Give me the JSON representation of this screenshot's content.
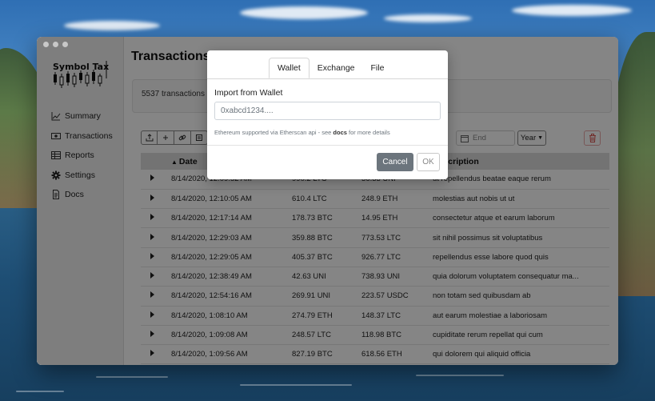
{
  "app": {
    "logo_text": "Symbol Tax",
    "page_title": "Transactions"
  },
  "sidebar": {
    "items": [
      {
        "label": "Summary",
        "icon": "chart-line-icon"
      },
      {
        "label": "Transactions",
        "icon": "cash-icon"
      },
      {
        "label": "Reports",
        "icon": "table-icon"
      },
      {
        "label": "Settings",
        "icon": "gear-icon"
      },
      {
        "label": "Docs",
        "icon": "document-icon"
      }
    ]
  },
  "summary": {
    "text": "5537 transactions"
  },
  "toolbar": {
    "icons": [
      "upload-icon",
      "plus-icon",
      "link-icon",
      "file-icon"
    ],
    "end_placeholder": "End",
    "year_label": "Year"
  },
  "table": {
    "columns": [
      "Date",
      "",
      "",
      "Description"
    ],
    "rows": [
      {
        "date": "8/14/2020, 12:09:52 AM",
        "sent": "990.2 LTC",
        "received": "36.33 UNI",
        "description": "ut repellendus beatae eaque rerum"
      },
      {
        "date": "8/14/2020, 12:10:05 AM",
        "sent": "610.4 LTC",
        "received": "248.9 ETH",
        "description": "molestias aut nobis ut ut"
      },
      {
        "date": "8/14/2020, 12:17:14 AM",
        "sent": "178.73 BTC",
        "received": "14.95 ETH",
        "description": "consectetur atque et earum laborum"
      },
      {
        "date": "8/14/2020, 12:29:03 AM",
        "sent": "359.88 BTC",
        "received": "773.53 LTC",
        "description": "sit nihil possimus sit voluptatibus"
      },
      {
        "date": "8/14/2020, 12:29:05 AM",
        "sent": "405.37 BTC",
        "received": "926.77 LTC",
        "description": "repellendus esse labore quod quis"
      },
      {
        "date": "8/14/2020, 12:38:49 AM",
        "sent": "42.63 UNI",
        "received": "738.93 UNI",
        "description": "quia dolorum voluptatem consequatur ma..."
      },
      {
        "date": "8/14/2020, 12:54:16 AM",
        "sent": "269.91 UNI",
        "received": "223.57 USDC",
        "description": "non totam sed quibusdam ab"
      },
      {
        "date": "8/14/2020, 1:08:10 AM",
        "sent": "274.79 ETH",
        "received": "148.37 LTC",
        "description": "aut earum molestiae a laboriosam"
      },
      {
        "date": "8/14/2020, 1:09:08 AM",
        "sent": "248.57 LTC",
        "received": "118.98 BTC",
        "description": "cupiditate rerum repellat qui cum"
      },
      {
        "date": "8/14/2020, 1:09:56 AM",
        "sent": "827.19 BTC",
        "received": "618.56 ETH",
        "description": "qui dolorem qui aliquid officia"
      }
    ]
  },
  "modal": {
    "tabs": [
      "Wallet",
      "Exchange",
      "File"
    ],
    "active_tab": "Wallet",
    "label": "Import from Wallet",
    "input_placeholder": "0xabcd1234....",
    "help_prefix": "Ethereum supported via Etherscan api - see ",
    "help_link": "docs",
    "help_suffix": " for more details",
    "cancel_label": "Cancel",
    "ok_label": "OK"
  },
  "colors": {
    "cancel_button": "#6c757d",
    "trash_icon": "#d9534f",
    "overlay": "rgba(0,0,0,0.48)"
  }
}
